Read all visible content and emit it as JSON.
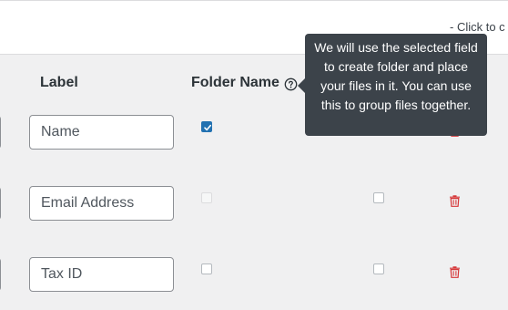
{
  "top_hint": "- Click to c",
  "columns": {
    "label": "Label",
    "folder_name": "Folder Name"
  },
  "tooltip": {
    "text": "We will use the selected field to create folder and place your files in it. You can use this to group files together."
  },
  "rows": [
    {
      "label_value": "Name",
      "folder_checked": true
    },
    {
      "label_value": "Email Address",
      "folder_checked": false
    },
    {
      "label_value": "Tax ID",
      "folder_checked": false
    }
  ],
  "colors": {
    "accent": "#2271b1",
    "delete": "#d63638",
    "tooltip_bg": "#3c434a"
  },
  "icons": {
    "help": "help-circle-icon",
    "delete": "trash-icon"
  }
}
